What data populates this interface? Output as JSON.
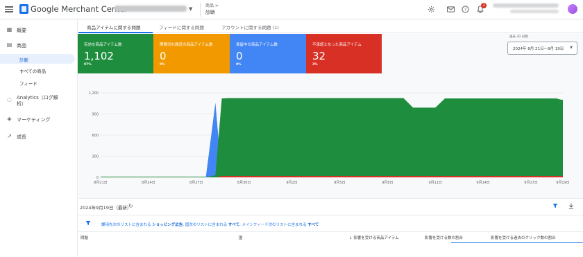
{
  "header": {
    "brand": "Google Merchant Center",
    "breadcrumb_parent": "商品 >",
    "page_title": "診断",
    "notification_count": "2",
    "icons": [
      "menu-icon",
      "settings-icon",
      "mail-icon",
      "help-icon",
      "bell-icon"
    ]
  },
  "sidebar": {
    "items": [
      {
        "label": "概要",
        "icon": "dashboard-icon"
      },
      {
        "label": "商品",
        "icon": "product-icon"
      },
      {
        "label": "診断",
        "active": true
      },
      {
        "label": "すべての商品"
      },
      {
        "label": "フィード"
      },
      {
        "label": "Analytics（ログ解析）",
        "icon": "analytics-icon"
      },
      {
        "label": "マーケティング",
        "icon": "marketing-icon"
      },
      {
        "label": "成長",
        "icon": "growth-icon"
      }
    ]
  },
  "tabs": [
    {
      "label": "商品アイテムに関する問題",
      "active": true
    },
    {
      "label": "フィードに関する問題"
    },
    {
      "label": "アカウントに関する問題 (1)"
    }
  ],
  "cards": [
    {
      "title": "有効な商品アイテム数",
      "value": "1,102",
      "pct": "97%",
      "color": "#1e8e3e"
    },
    {
      "title": "期限切れ間近の商品アイテム数",
      "value": "0",
      "pct": "0%",
      "color": "#f29900"
    },
    {
      "title": "保留中の商品アイテム数",
      "value": "0",
      "pct": "0%",
      "color": "#4285f4"
    },
    {
      "title": "不承認となった商品アイテム",
      "value": "32",
      "pct": "3%",
      "color": "#d93025"
    }
  ],
  "date_range": {
    "label": "過去 30 日間",
    "value": "2024年 8月 21日〜9月 19日"
  },
  "report": {
    "date": "2024年9月19日（最新）"
  },
  "filter": {
    "text_1": "課用先次のリストに含まれる",
    "bold_1": "ショッピング広告",
    "text_2": "国次のリストに含まれる",
    "bold_2": "すべて",
    "text_3": "メインフィード次のリストに含まれる",
    "bold_3": "すべて"
  },
  "table": {
    "columns": [
      "問題",
      "国",
      "↓ 影響を受ける商品アイテム",
      "影響を受ける数の割合",
      "影響を受ける過去のクリック数の割合"
    ]
  },
  "chart_data": {
    "type": "area",
    "title": "",
    "xlabel": "",
    "ylabel": "",
    "ylim": [
      0,
      1200
    ],
    "y_ticks": [
      0,
      300,
      600,
      900,
      1200
    ],
    "y_tick_labels": [
      "0",
      "300",
      "600",
      "900",
      "1,200"
    ],
    "x_tick_labels": [
      "8月21日",
      "8月24日",
      "8月27日",
      "8月30日",
      "9月2日",
      "9月5日",
      "9月8日",
      "9月11日",
      "9月14日",
      "9月17日",
      "9月19日"
    ],
    "x_tick_days": [
      0,
      3,
      6,
      9,
      12,
      15,
      18,
      21,
      24,
      27,
      29
    ],
    "x_range": [
      0,
      29
    ],
    "stacked": true,
    "grid": true,
    "series": [
      {
        "color": "#d93025",
        "x": [
          0,
          7.3,
          7.6,
          29
        ],
        "values": [
          0,
          0,
          20,
          20
        ]
      },
      {
        "color": "#4285f4",
        "x": [
          0,
          6.6,
          7.2,
          7.6,
          29
        ],
        "values": [
          0,
          0,
          1060,
          0,
          0
        ]
      },
      {
        "color": "#1e8e3e",
        "x": [
          0,
          6.6,
          7.2,
          7.6,
          8.0,
          19.0,
          19.6,
          21.0,
          21.6,
          28.6,
          28.9,
          29
        ],
        "values": [
          0,
          0,
          30,
          1120,
          1125,
          1125,
          990,
          990,
          1120,
          1120,
          1102,
          1102
        ]
      }
    ]
  }
}
